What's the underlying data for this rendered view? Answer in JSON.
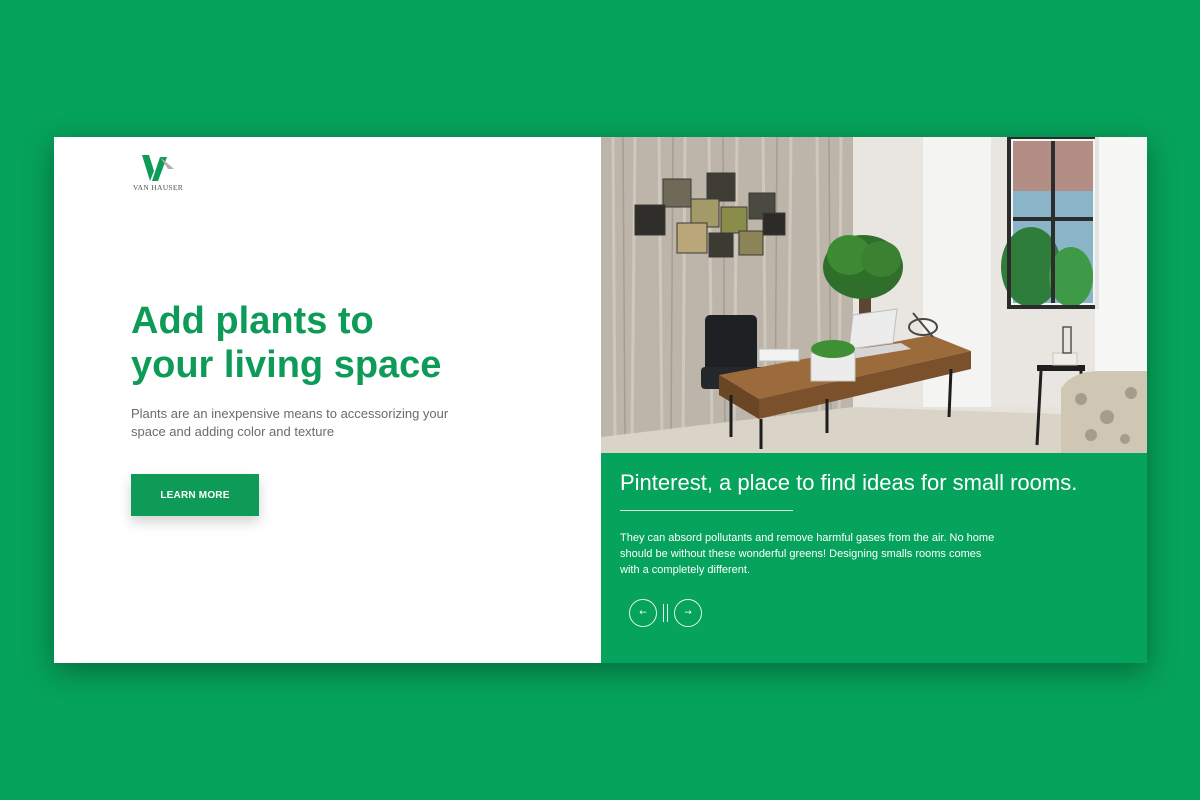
{
  "brand": {
    "name": "VAN HAUSER",
    "logo_icon": "vh-leaf-logo-icon"
  },
  "hero": {
    "title_line1": "Add plants to",
    "title_line2": "your living space",
    "subtitle_line1": "Plants are an inexpensive means to accessorizing your",
    "subtitle_line2": "space and adding color and texture",
    "cta_label": "LEARN MORE"
  },
  "panel": {
    "title": "Pinterest, a place to find ideas for small rooms.",
    "body_line1": "They can absord pollutants and remove harmful gases from the air. No home",
    "body_line2": "should be without these wonderful greens! Designing smalls rooms comes",
    "body_line3": "with a completely different.",
    "prev_icon": "arrow-left-icon",
    "next_icon": "arrow-right-icon",
    "prev_glyph": "←",
    "next_glyph": "→"
  },
  "colors": {
    "background": "#06a35c",
    "accent": "#0e9b57",
    "text_muted": "#6b6b6b"
  }
}
